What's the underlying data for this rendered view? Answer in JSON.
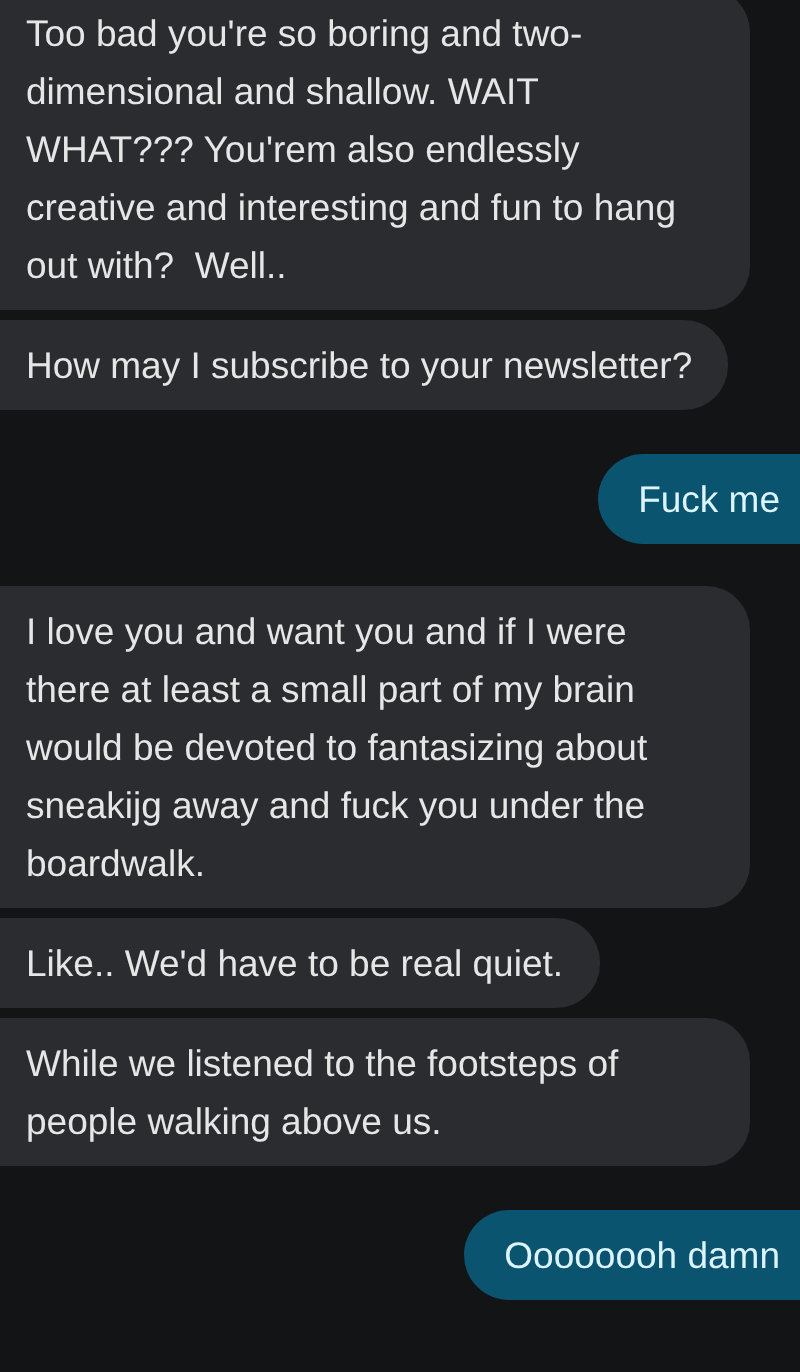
{
  "messages": [
    {
      "kind": "incoming",
      "text": "Too bad you're so boring and two-dimensional and shallow. WAIT WHAT??? You'rem also endlessly creative and interesting and fun to hang out with?  Well.."
    },
    {
      "kind": "incoming",
      "text": "How may I subscribe to your newsletter?"
    },
    {
      "kind": "outgoing",
      "text": "Fuck me"
    },
    {
      "kind": "incoming",
      "text": "I love you and want you and if I were there at least a small part of my brain would be devoted to fantasizing about sneakijg away and fuck you under the boardwalk."
    },
    {
      "kind": "incoming",
      "text": "Like.. We'd have to be real quiet."
    },
    {
      "kind": "incoming",
      "text": "While we listened to the footsteps of people walking above us."
    },
    {
      "kind": "outgoing",
      "text": "Oooooooh damn"
    }
  ]
}
